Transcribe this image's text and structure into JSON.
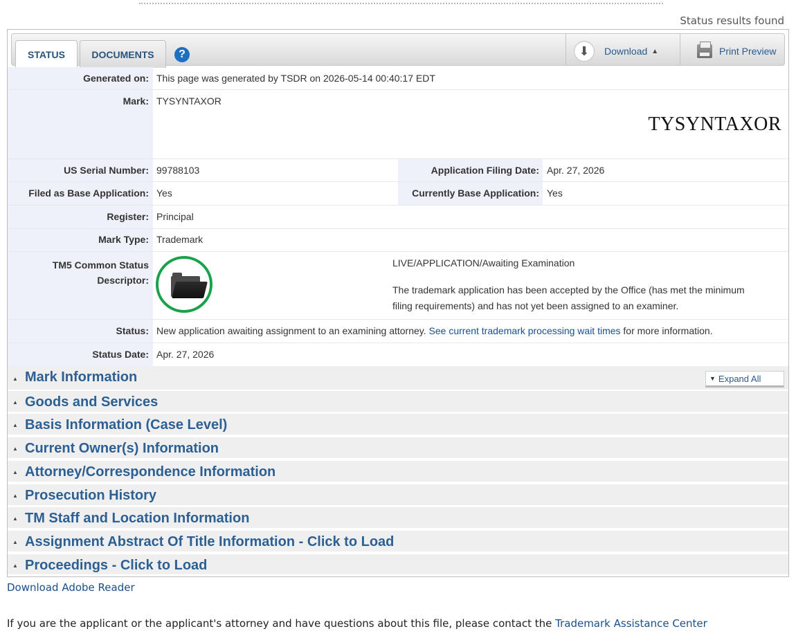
{
  "results_found": "Status results found",
  "tabs": {
    "status": "STATUS",
    "documents": "DOCUMENTS",
    "help": "?"
  },
  "toolbar": {
    "download": "Download",
    "download_caret": "▲",
    "print_preview": "Print Preview"
  },
  "fields": {
    "generated_on": {
      "label": "Generated on:",
      "value": "This page was generated by TSDR on 2026-05-14 00:40:17 EDT"
    },
    "mark": {
      "label": "Mark:",
      "value": "TYSYNTAXOR",
      "image_text": "TYSYNTAXOR"
    },
    "serial": {
      "label": "US Serial Number:",
      "value": "99788103"
    },
    "filing_date": {
      "label": "Application Filing Date:",
      "value": "Apr. 27, 2026"
    },
    "filed_base": {
      "label": "Filed as Base Application:",
      "value": "Yes"
    },
    "currently_base": {
      "label": "Currently Base Application:",
      "value": "Yes"
    },
    "register": {
      "label": "Register:",
      "value": "Principal"
    },
    "mark_type": {
      "label": "Mark Type:",
      "value": "Trademark"
    },
    "tm5": {
      "label_line1": "TM5 Common Status",
      "label_line2": "Descriptor:",
      "title": "LIVE/APPLICATION/Awaiting Examination",
      "desc_line1": "The trademark application has been accepted by the Office (has met the minimum",
      "desc_line2": "filing requirements) and has not yet been assigned to an examiner."
    },
    "status": {
      "label": "Status:",
      "text_before": "New application awaiting assignment to an examining attorney. ",
      "link": "See current trademark processing wait times",
      "text_after": " for more information."
    },
    "status_date": {
      "label": "Status Date:",
      "value": "Apr. 27, 2026"
    }
  },
  "expand_all": "Expand All",
  "sections": [
    "Mark Information",
    "Goods and Services",
    "Basis Information (Case Level)",
    "Current Owner(s) Information",
    "Attorney/Correspondence Information",
    "Prosecution History",
    "TM Staff and Location Information",
    "Assignment Abstract Of Title Information - Click to Load",
    "Proceedings - Click to Load"
  ],
  "adobe_link": "Download Adobe Reader",
  "footer": {
    "text": "If you are the applicant or the applicant's attorney and have questions about this file, please contact the ",
    "link": "Trademark Assistance Center"
  }
}
